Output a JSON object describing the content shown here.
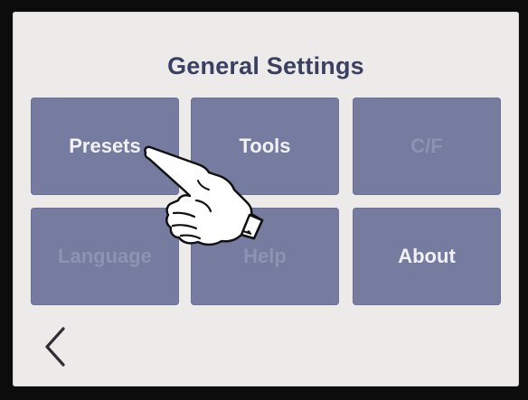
{
  "screen": {
    "title": "General Settings",
    "tiles": [
      {
        "label": "Presets",
        "enabled": true
      },
      {
        "label": "Tools",
        "enabled": true
      },
      {
        "label": "C/F",
        "enabled": false
      },
      {
        "label": "Language",
        "enabled": false
      },
      {
        "label": "Help",
        "enabled": false
      },
      {
        "label": "About",
        "enabled": true
      }
    ],
    "icons": {
      "back": "chevron-left-icon",
      "pointer": "pointing-hand-icon"
    }
  },
  "colors": {
    "screen_bg": "#ecebe9",
    "title": "#3b3f61",
    "tile_bg": "#757c9f",
    "tile_text": "#f2f2f5",
    "tile_text_disabled": "#8d93b0"
  }
}
